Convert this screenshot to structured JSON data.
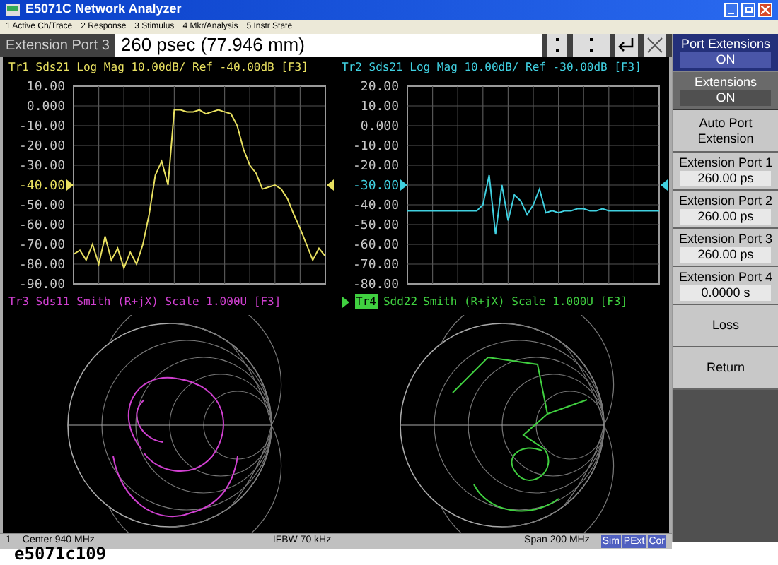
{
  "window": {
    "title": "E5071C Network Analyzer"
  },
  "menu": [
    "1 Active Ch/Trace",
    "2 Response",
    "3 Stimulus",
    "4 Mkr/Analysis",
    "5 Instr State"
  ],
  "entry": {
    "label": "Extension Port 3",
    "value": "260 psec (77.946 mm)"
  },
  "panels": [
    {
      "kind": "logmag",
      "title": "Tr1 Sds21 Log Mag 10.00dB/ Ref -40.00dB [F3]",
      "color": "#e8e060",
      "reference_label": "-40.00",
      "chart_data": {
        "type": "line",
        "grid": true,
        "ylim": [
          -90,
          10
        ],
        "yticks": [
          {
            "value": 10,
            "label": "10.00"
          },
          {
            "value": 0,
            "label": "0.000"
          },
          {
            "value": -10,
            "label": "-10.00"
          },
          {
            "value": -20,
            "label": "-20.00"
          },
          {
            "value": -30,
            "label": "-30.00"
          },
          {
            "value": -50,
            "label": "-50.00"
          },
          {
            "value": -60,
            "label": "-60.00"
          },
          {
            "value": -70,
            "label": "-70.00"
          },
          {
            "value": -80,
            "label": "-80.00"
          },
          {
            "value": -90,
            "label": "-90.00"
          }
        ],
        "series": [
          {
            "color": "#e8e060",
            "values": [
              -75,
              -73,
              -78,
              -70,
              -80,
              -66,
              -78,
              -72,
              -82,
              -74,
              -80,
              -70,
              -55,
              -35,
              -28,
              -40,
              -2,
              -2,
              -3,
              -3,
              -2,
              -4,
              -3,
              -2,
              -3,
              -4,
              -10,
              -22,
              -30,
              -34,
              -42,
              -41,
              -40,
              -42,
              -47,
              -55,
              -62,
              -70,
              -78,
              -72,
              -76
            ]
          }
        ]
      }
    },
    {
      "kind": "logmag",
      "title": "Tr2 Sds21 Log Mag 10.00dB/ Ref -30.00dB [F3]",
      "color": "#40d0e0",
      "reference_label": "-30.00",
      "chart_data": {
        "type": "line",
        "grid": true,
        "ylim": [
          -80,
          20
        ],
        "yticks": [
          {
            "value": 20,
            "label": "20.00"
          },
          {
            "value": 10,
            "label": "10.00"
          },
          {
            "value": 0,
            "label": "0.000"
          },
          {
            "value": -10,
            "label": "-10.00"
          },
          {
            "value": -20,
            "label": "-20.00"
          },
          {
            "value": -40,
            "label": "-40.00"
          },
          {
            "value": -50,
            "label": "-50.00"
          },
          {
            "value": -60,
            "label": "-60.00"
          },
          {
            "value": -70,
            "label": "-70.00"
          },
          {
            "value": -80,
            "label": "-80.00"
          }
        ],
        "series": [
          {
            "color": "#40d0e0",
            "values": [
              -43,
              -43,
              -43,
              -43,
              -43,
              -43,
              -43,
              -43,
              -43,
              -43,
              -43,
              -43,
              -40,
              -25,
              -55,
              -30,
              -48,
              -35,
              -38,
              -45,
              -40,
              -32,
              -44,
              -43,
              -44,
              -43,
              -43,
              -42,
              -42,
              -43,
              -43,
              -42,
              -43,
              -43,
              -43,
              -43,
              -43,
              -43,
              -43,
              -43,
              -43
            ]
          }
        ]
      }
    },
    {
      "kind": "smith",
      "title": "Tr3 Sds11 Smith (R+jX) Scale 1.000U [F3]",
      "color": "#d040d0"
    },
    {
      "kind": "smith",
      "title": "Smith (R+jX) Scale 1.000U [F3]",
      "badge": "Tr4",
      "trace_label": "Sdd22",
      "color": "#40d040",
      "active": true
    }
  ],
  "softkeys": [
    {
      "kind": "title",
      "label": "Port Extensions",
      "value": "ON"
    },
    {
      "kind": "toggle",
      "label": "Extensions",
      "value": "ON"
    },
    {
      "kind": "menu",
      "label": "Auto Port Extension"
    },
    {
      "kind": "value",
      "label": "Extension Port 1",
      "value": "260.00 ps"
    },
    {
      "kind": "value",
      "label": "Extension Port 2",
      "value": "260.00 ps"
    },
    {
      "kind": "value",
      "label": "Extension Port 3",
      "value": "260.00 ps"
    },
    {
      "kind": "value",
      "label": "Extension Port 4",
      "value": "0.0000 s"
    },
    {
      "kind": "menu",
      "label": "Loss"
    },
    {
      "kind": "plain",
      "label": "Return"
    }
  ],
  "status_bar": {
    "channel": "1",
    "center": "Center 940 MHz",
    "ifbw": "IFBW 70 kHz",
    "span": "Span 200 MHz",
    "badges": [
      "Sim",
      "PExt",
      "Cor"
    ]
  },
  "caption": "e5071c109"
}
